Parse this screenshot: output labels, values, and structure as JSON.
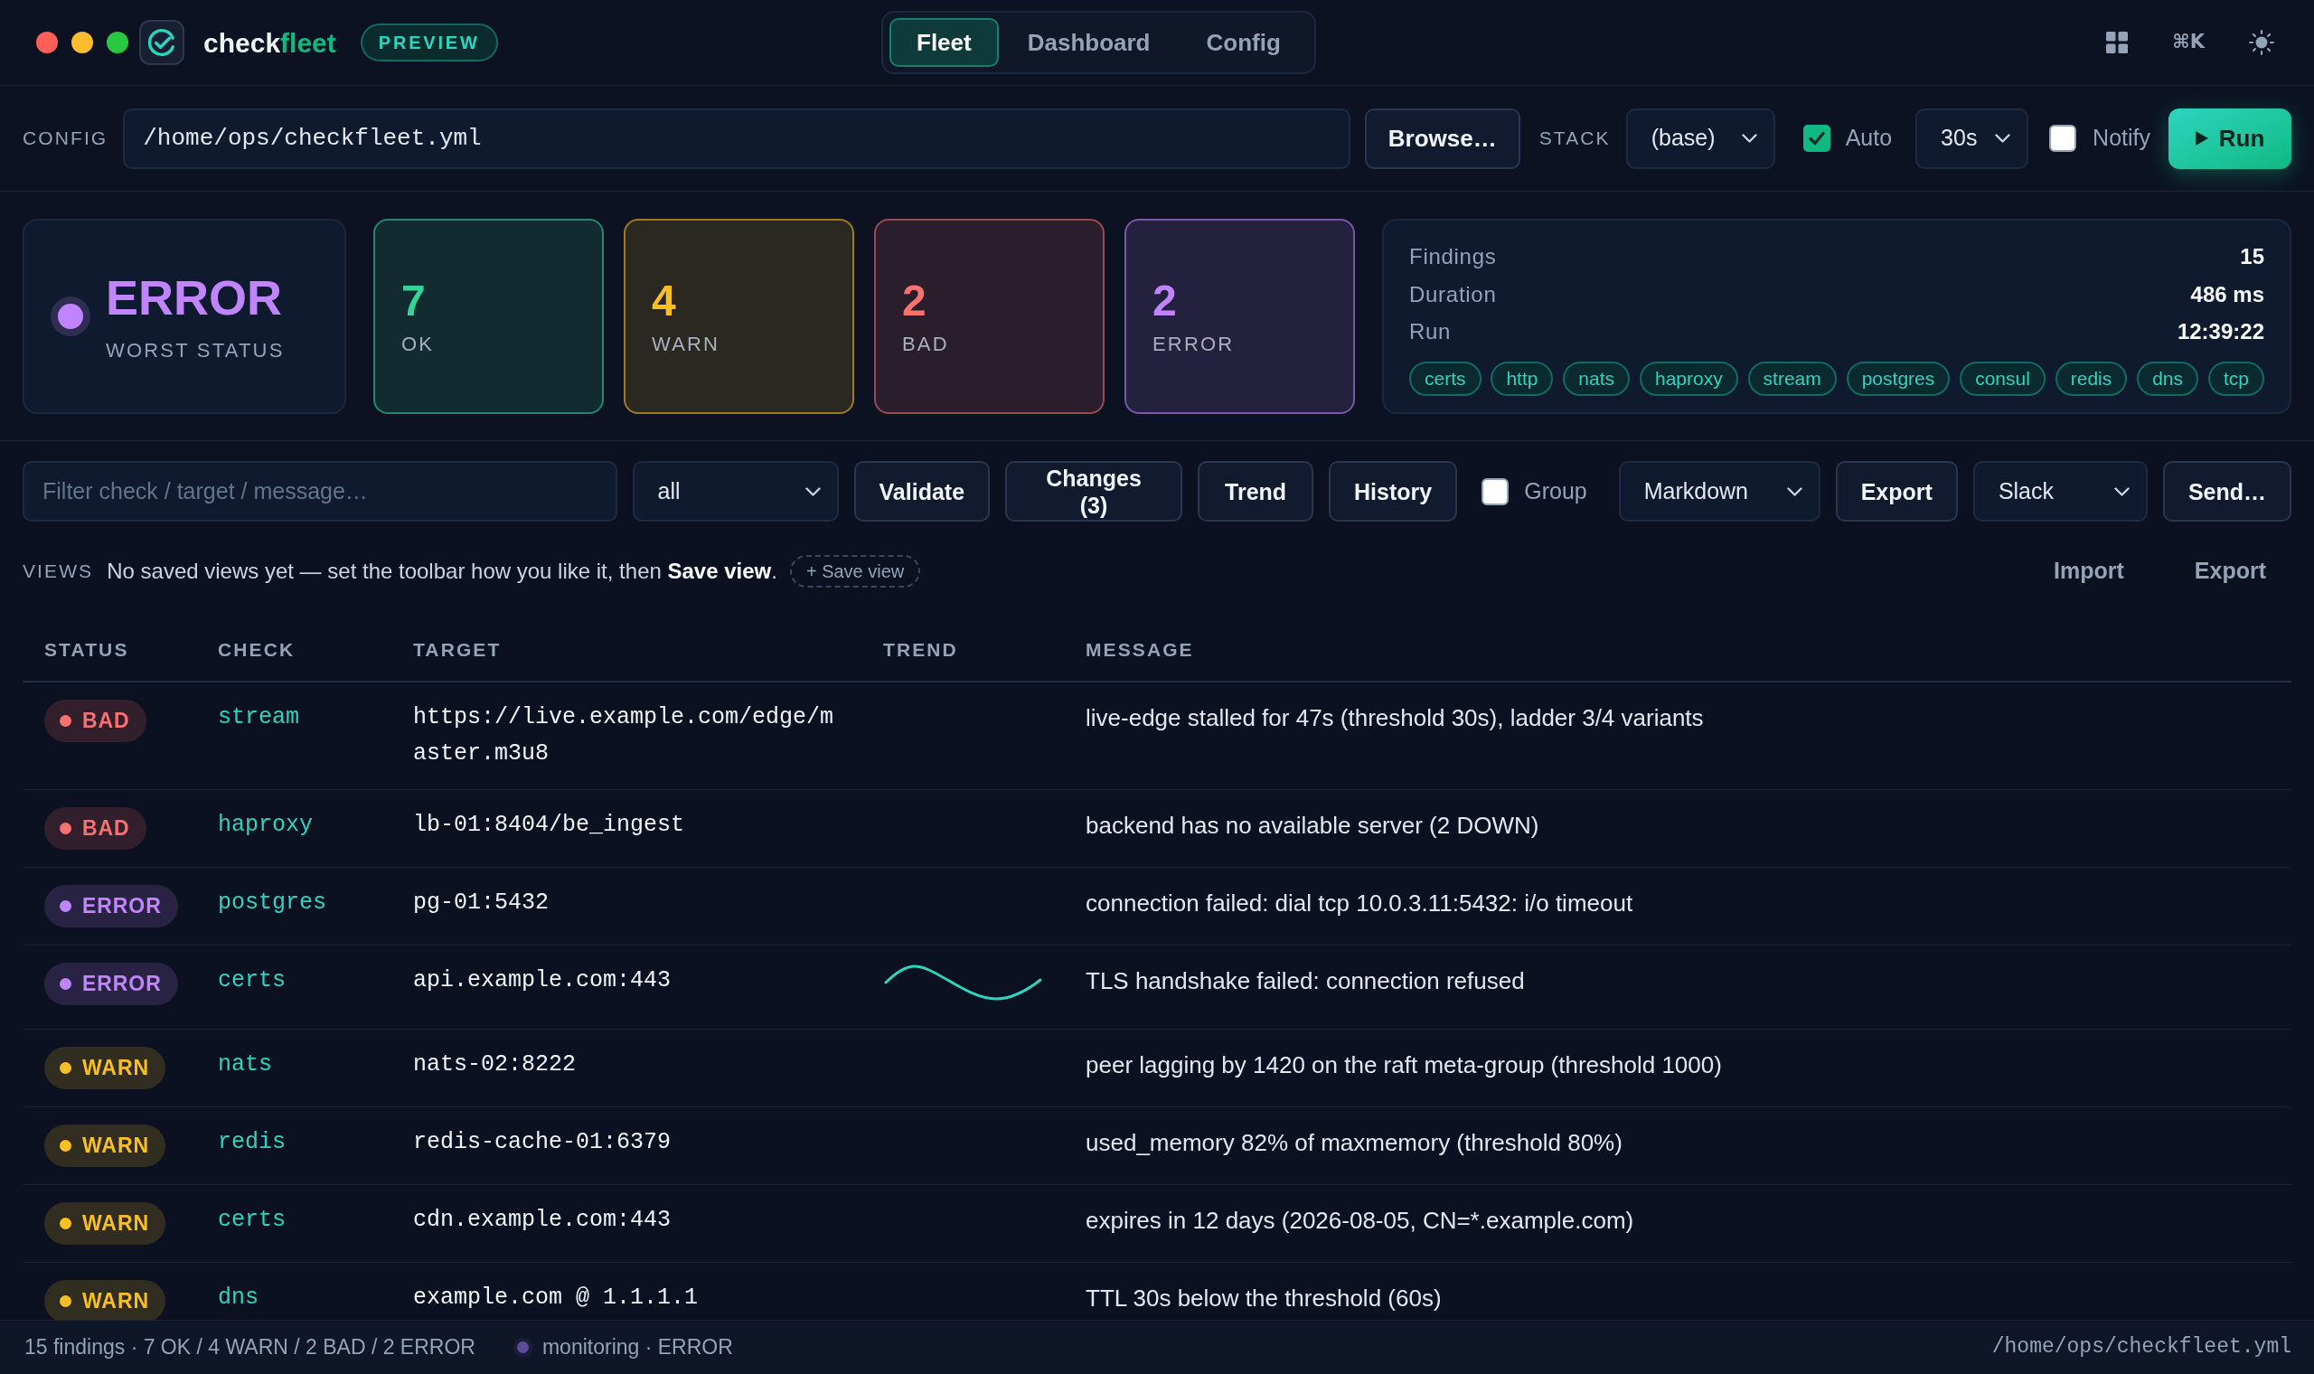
{
  "header": {
    "app_name": {
      "text": "check",
      "accent": "fleet"
    },
    "badge": "PREVIEW",
    "tabs": [
      {
        "label": "Fleet",
        "selected": true
      },
      {
        "label": "Dashboard",
        "selected": false
      },
      {
        "label": "Config",
        "selected": false
      }
    ],
    "shortcut": "⌘K"
  },
  "config_bar": {
    "label": "CONFIG",
    "path": "/home/ops/checkfleet.yml",
    "browse_button": "Browse…",
    "stack_label": "STACK",
    "stack": "(base)",
    "auto": {
      "label": "Auto",
      "checked": true
    },
    "interval": "30s",
    "notify": {
      "label": "Notify",
      "checked": false
    },
    "run_button": "Run"
  },
  "summary": {
    "worst": {
      "color": "#c084fc",
      "value": "ERROR",
      "label": "WORST STATUS"
    },
    "counts": [
      {
        "color": "#34d399",
        "count": "7",
        "label": "OK"
      },
      {
        "color": "#fbbf24",
        "count": "4",
        "label": "WARN"
      },
      {
        "color": "#f87171",
        "count": "2",
        "label": "BAD"
      },
      {
        "color": "#c084fc",
        "count": "2",
        "label": "ERROR"
      }
    ],
    "details": [
      {
        "label": "Findings",
        "value": "15"
      },
      {
        "label": "Duration",
        "value": "486 ms"
      },
      {
        "label": "Run",
        "value": "12:39:22"
      }
    ],
    "tags": [
      "certs",
      "http",
      "nats",
      "haproxy",
      "stream",
      "postgres",
      "consul",
      "redis",
      "dns",
      "tcp"
    ]
  },
  "toolbar": [
    {
      "kind": "input",
      "placeholder": "Filter check / target / message…"
    },
    {
      "kind": "select",
      "value": "all"
    },
    {
      "kind": "button",
      "label": "Validate"
    },
    {
      "kind": "button",
      "label": "Changes (3)"
    },
    {
      "kind": "button",
      "label": "Trend"
    },
    {
      "kind": "button",
      "label": "History"
    },
    {
      "kind": "checkbox",
      "label": "Group",
      "checked": false
    },
    {
      "kind": "select",
      "value": "Markdown"
    },
    {
      "kind": "button",
      "label": "Export"
    },
    {
      "kind": "select",
      "value": "Slack"
    },
    {
      "kind": "button",
      "label": "Send…"
    }
  ],
  "views": {
    "label": "VIEWS",
    "hint": "No saved views yet — set the toolbar how you like it, then **Save view**.",
    "save_button": "+ Save view",
    "actions": [
      "Import",
      "Export"
    ]
  },
  "table": {
    "columns": [
      "STATUS",
      "CHECK",
      "TARGET",
      "TREND",
      "MESSAGE"
    ],
    "rows": [
      {
        "color": "#f87171",
        "status_label": "BAD",
        "check": "stream",
        "target": "https://live.example.com/edge/master.m3u8",
        "sparkline": false,
        "message": "live-edge stalled for 47s (threshold 30s), ladder 3/4 variants"
      },
      {
        "color": "#f87171",
        "status_label": "BAD",
        "check": "haproxy",
        "target": "lb-01:8404/be_ingest",
        "sparkline": false,
        "message": "backend has no available server (2 DOWN)"
      },
      {
        "color": "#c084fc",
        "status_label": "ERROR",
        "check": "postgres",
        "target": "pg-01:5432",
        "sparkline": false,
        "message": "connection failed: dial tcp 10.0.3.11:5432: i/o timeout"
      },
      {
        "color": "#c084fc",
        "status_label": "ERROR",
        "check": "certs",
        "target": "api.example.com:443",
        "sparkline": true,
        "message": "TLS handshake failed: connection refused"
      },
      {
        "color": "#fbbf24",
        "status_label": "WARN",
        "check": "nats",
        "target": "nats-02:8222",
        "sparkline": false,
        "message": "peer lagging by 1420 on the raft meta-group (threshold 1000)"
      },
      {
        "color": "#fbbf24",
        "status_label": "WARN",
        "check": "redis",
        "target": "redis-cache-01:6379",
        "sparkline": false,
        "message": "used_memory 82% of maxmemory (threshold 80%)"
      },
      {
        "color": "#fbbf24",
        "status_label": "WARN",
        "check": "certs",
        "target": "cdn.example.com:443",
        "sparkline": false,
        "message": "expires in 12 days (2026-08-05, CN=*.example.com)"
      },
      {
        "color": "#fbbf24",
        "status_label": "WARN",
        "check": "dns",
        "target": "example.com @ 1.1.1.1",
        "sparkline": false,
        "message": "TTL 30s below the threshold (60s)"
      }
    ]
  },
  "status_bar": {
    "summary": "15 findings · 7 OK / 4 WARN / 2 BAD / 2 ERROR",
    "monitor": {
      "color": "#5e4a9a",
      "text": "monitoring · ERROR"
    },
    "path": "/home/ops/checkfleet.yml"
  }
}
